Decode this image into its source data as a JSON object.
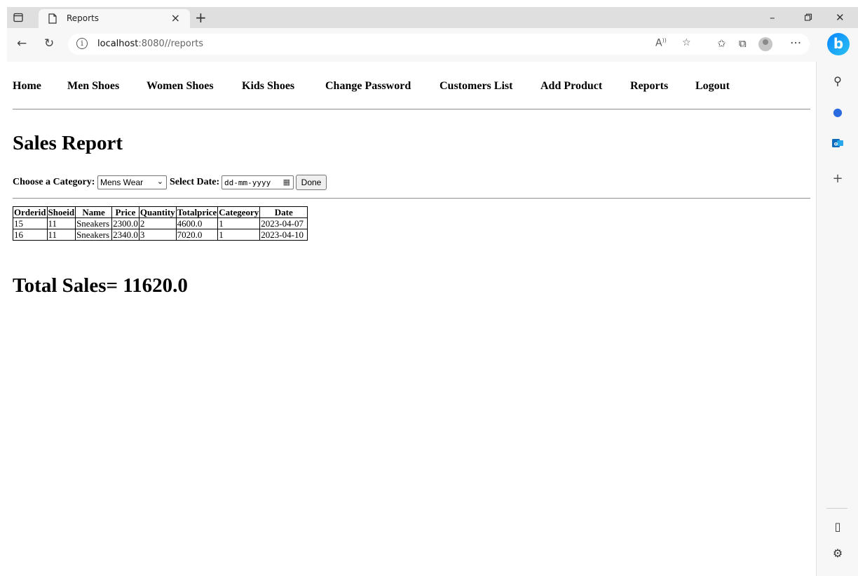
{
  "browser": {
    "tab_title": "Reports",
    "tab_close": "×",
    "new_tab": "+",
    "url_host": "localhost",
    "url_path": ":8080//reports",
    "more_menu": "···"
  },
  "nav": {
    "items": [
      "Home",
      "Men Shoes",
      "Women Shoes",
      "Kids Shoes",
      "Change Password",
      "Customers List",
      "Add Product",
      "Reports",
      "Logout"
    ]
  },
  "page": {
    "title": "Sales Report"
  },
  "filter": {
    "category_label": "Choose a Category:",
    "category_value": "Mens Wear",
    "date_label": "Select Date:",
    "date_placeholder": "dd-mm-yyyy",
    "done_label": "Done"
  },
  "table": {
    "headers": [
      "Orderid",
      "Shoeid",
      "Name",
      "Price",
      "Quantity",
      "Totalprice",
      "Categeory",
      "Date"
    ],
    "rows": [
      [
        "15",
        "11",
        "Sneakers",
        "2300.0",
        "2",
        "4600.0",
        "1",
        "2023-04-07"
      ],
      [
        "16",
        "11",
        "Sneakers",
        "2340.0",
        "3",
        "7020.0",
        "1",
        "2023-04-10"
      ]
    ]
  },
  "summary": {
    "total_text": "Total Sales= 11620.0"
  },
  "icons": {
    "accent": "#0a84ff",
    "copilot_color": "#2b6be0",
    "outlook_color": "#0f6cbd"
  }
}
